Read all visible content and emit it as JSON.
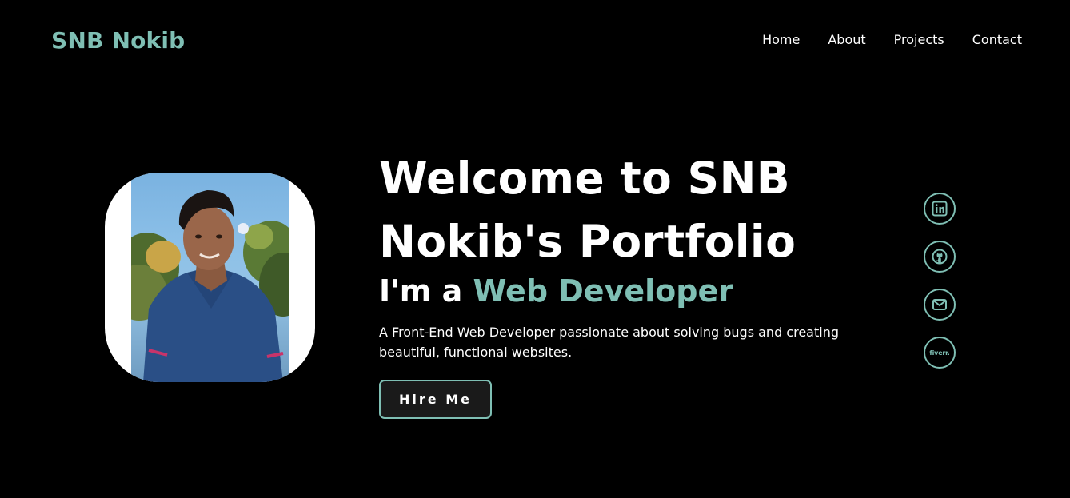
{
  "header": {
    "logo": "SNB Nokib",
    "nav": [
      "Home",
      "About",
      "Projects",
      "Contact"
    ]
  },
  "hero": {
    "title": "Welcome to SNB Nokib's Portfolio",
    "subtitle_prefix": "I'm a ",
    "subtitle_accent": "Web Developer",
    "description": "A Front-End Web Developer passionate about solving bugs and creating beautiful, functional websites.",
    "cta_label": "Hire Me"
  },
  "socials": [
    {
      "icon": "linkedin-icon"
    },
    {
      "icon": "github-icon"
    },
    {
      "icon": "mail-icon"
    },
    {
      "icon": "fiverr-icon",
      "label": "fiverr."
    }
  ],
  "colors": {
    "accent": "#7fbfb4",
    "background": "#000000",
    "text": "#ffffff"
  }
}
